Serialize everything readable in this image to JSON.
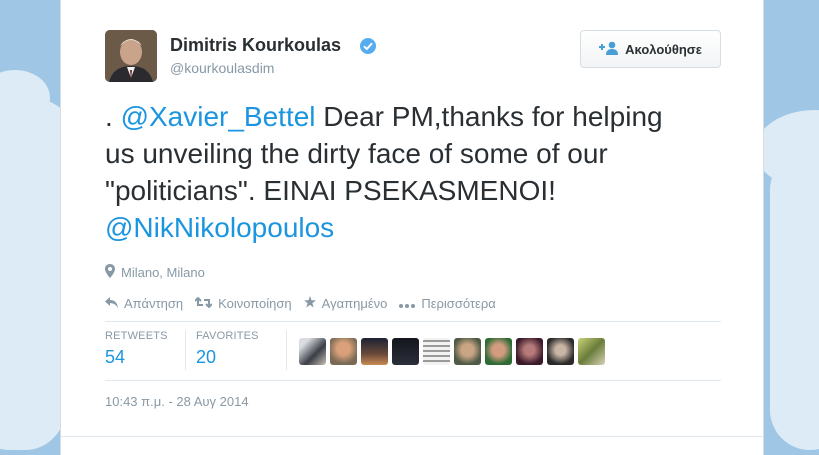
{
  "user": {
    "name": "Dimitris Kourkoulas",
    "handle": "@kourkoulasdim",
    "verified_icon": "verified-badge-icon"
  },
  "follow_button": {
    "label": "Ακολούθησε",
    "icon": "add-user-icon"
  },
  "tweet": {
    "prefix": ". ",
    "mention1": "@Xavier_Bettel",
    "body": " Dear PM,thanks for helping us unveiling the dirty face of some of our \"politicians\". EINAI PSEKASMENOI! ",
    "mention2": "@NikNikolopoulos"
  },
  "location": {
    "icon": "location-pin-icon",
    "text": "Milano, Milano"
  },
  "actions": {
    "reply": "Απάντηση",
    "retweet": "Κοινοποίηση",
    "favorite": "Αγαπημένο",
    "more": "Περισσότερα"
  },
  "stats": {
    "retweets_label": "RETWEETS",
    "retweets_value": "54",
    "favorites_label": "FAVORITES",
    "favorites_value": "20"
  },
  "timestamp": "10:43 π.μ. - 28 Αυγ 2014",
  "colors": {
    "link": "#1b95e0",
    "muted": "#8899a6",
    "text": "#292f33",
    "background": "#9fc6e4"
  }
}
